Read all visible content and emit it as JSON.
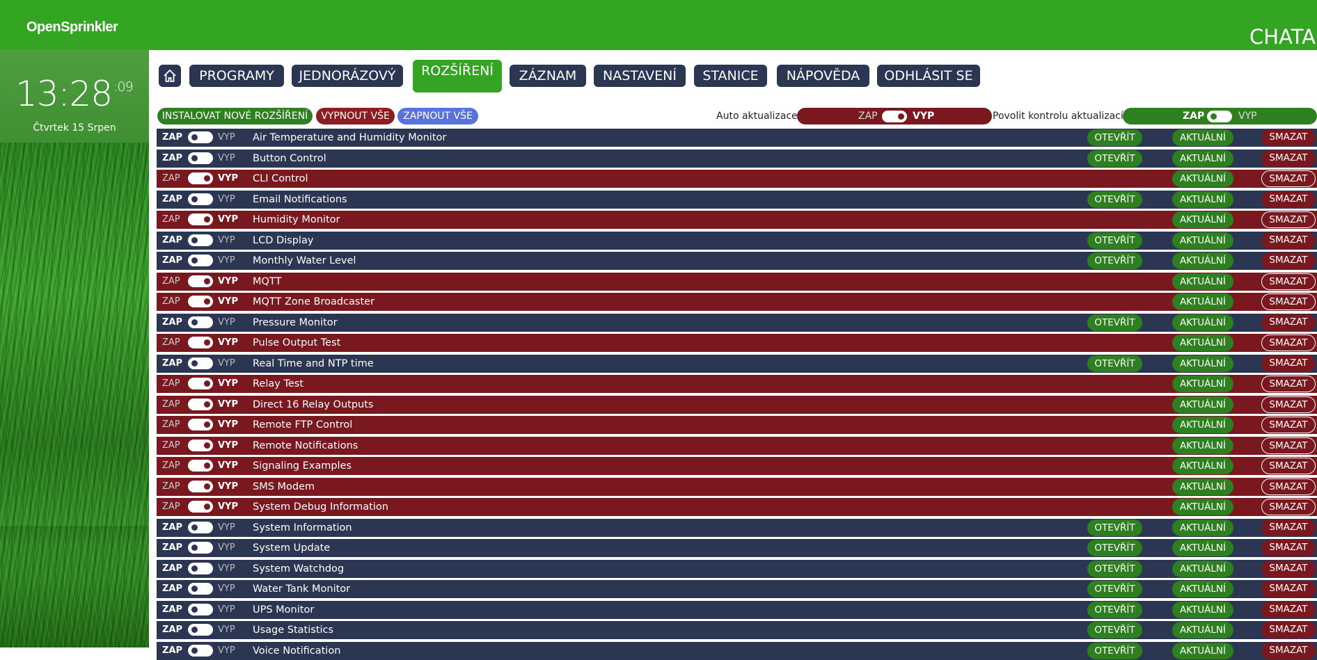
{
  "colors": {
    "header_green": "#33a523",
    "nav_blue": "#2b3653",
    "enabled_row": "#2b3653",
    "disabled_row": "#7a1820",
    "button_green": "#2e7f1f",
    "enable_all_blue": "#5a72de"
  },
  "header": {
    "logo": "OpenSprinkler",
    "device_name": "CHATA"
  },
  "sidebar": {
    "clock_hm": "13:28",
    "clock_sec": ":09",
    "date": "Čtvrtek 15 Srpen"
  },
  "nav": {
    "home_icon": "home-icon",
    "tabs": [
      {
        "label": "PROGRAMY"
      },
      {
        "label": "JEDNORÁZOVÝ"
      },
      {
        "label": "ROZŠÍŘENÍ",
        "active": true
      },
      {
        "label": "ZÁZNAM"
      },
      {
        "label": "NASTAVENÍ"
      },
      {
        "label": "STANICE"
      },
      {
        "label": "NÁPOVĚDA"
      },
      {
        "label": "ODHLÁSIT SE"
      }
    ]
  },
  "toolbar": {
    "install_label": "INSTALOVAT NOVÉ ROZŠÍŘENÍ",
    "disable_all_label": "VYPNOUT VŠE",
    "enable_all_label": "ZAPNOUT VŠE",
    "auto_update_label": "Auto aktualizace:",
    "auto_update_on": "ZAP",
    "auto_update_off": "VYP",
    "auto_update_state": "VYP",
    "check_updates_label": "Povolit kontrolu aktualizací:",
    "check_updates_on": "ZAP",
    "check_updates_off": "VYP",
    "check_updates_state": "ZAP"
  },
  "row_labels": {
    "on": "ZAP",
    "off": "VYP",
    "open": "OTEVŘÍT",
    "update": "AKTUÁLNÍ",
    "delete": "SMAZAT"
  },
  "extensions": [
    {
      "name": "Air Temperature and Humidity Monitor",
      "enabled": true
    },
    {
      "name": "Button Control",
      "enabled": true
    },
    {
      "name": "CLI Control",
      "enabled": false
    },
    {
      "name": "Email Notifications",
      "enabled": true
    },
    {
      "name": "Humidity Monitor",
      "enabled": false
    },
    {
      "name": "LCD Display",
      "enabled": true
    },
    {
      "name": "Monthly Water Level",
      "enabled": true
    },
    {
      "name": "MQTT",
      "enabled": false
    },
    {
      "name": "MQTT Zone Broadcaster",
      "enabled": false
    },
    {
      "name": "Pressure Monitor",
      "enabled": true
    },
    {
      "name": "Pulse Output Test",
      "enabled": false
    },
    {
      "name": "Real Time and NTP time",
      "enabled": true
    },
    {
      "name": "Relay Test",
      "enabled": false
    },
    {
      "name": "Direct 16 Relay Outputs",
      "enabled": false
    },
    {
      "name": "Remote FTP Control",
      "enabled": false
    },
    {
      "name": "Remote Notifications",
      "enabled": false
    },
    {
      "name": "Signaling Examples",
      "enabled": false
    },
    {
      "name": "SMS Modem",
      "enabled": false
    },
    {
      "name": "System Debug Information",
      "enabled": false
    },
    {
      "name": "System Information",
      "enabled": true
    },
    {
      "name": "System Update",
      "enabled": true
    },
    {
      "name": "System Watchdog",
      "enabled": true
    },
    {
      "name": "Water Tank Monitor",
      "enabled": true
    },
    {
      "name": "UPS Monitor",
      "enabled": true
    },
    {
      "name": "Usage Statistics",
      "enabled": true
    },
    {
      "name": "Voice Notification",
      "enabled": true
    }
  ]
}
